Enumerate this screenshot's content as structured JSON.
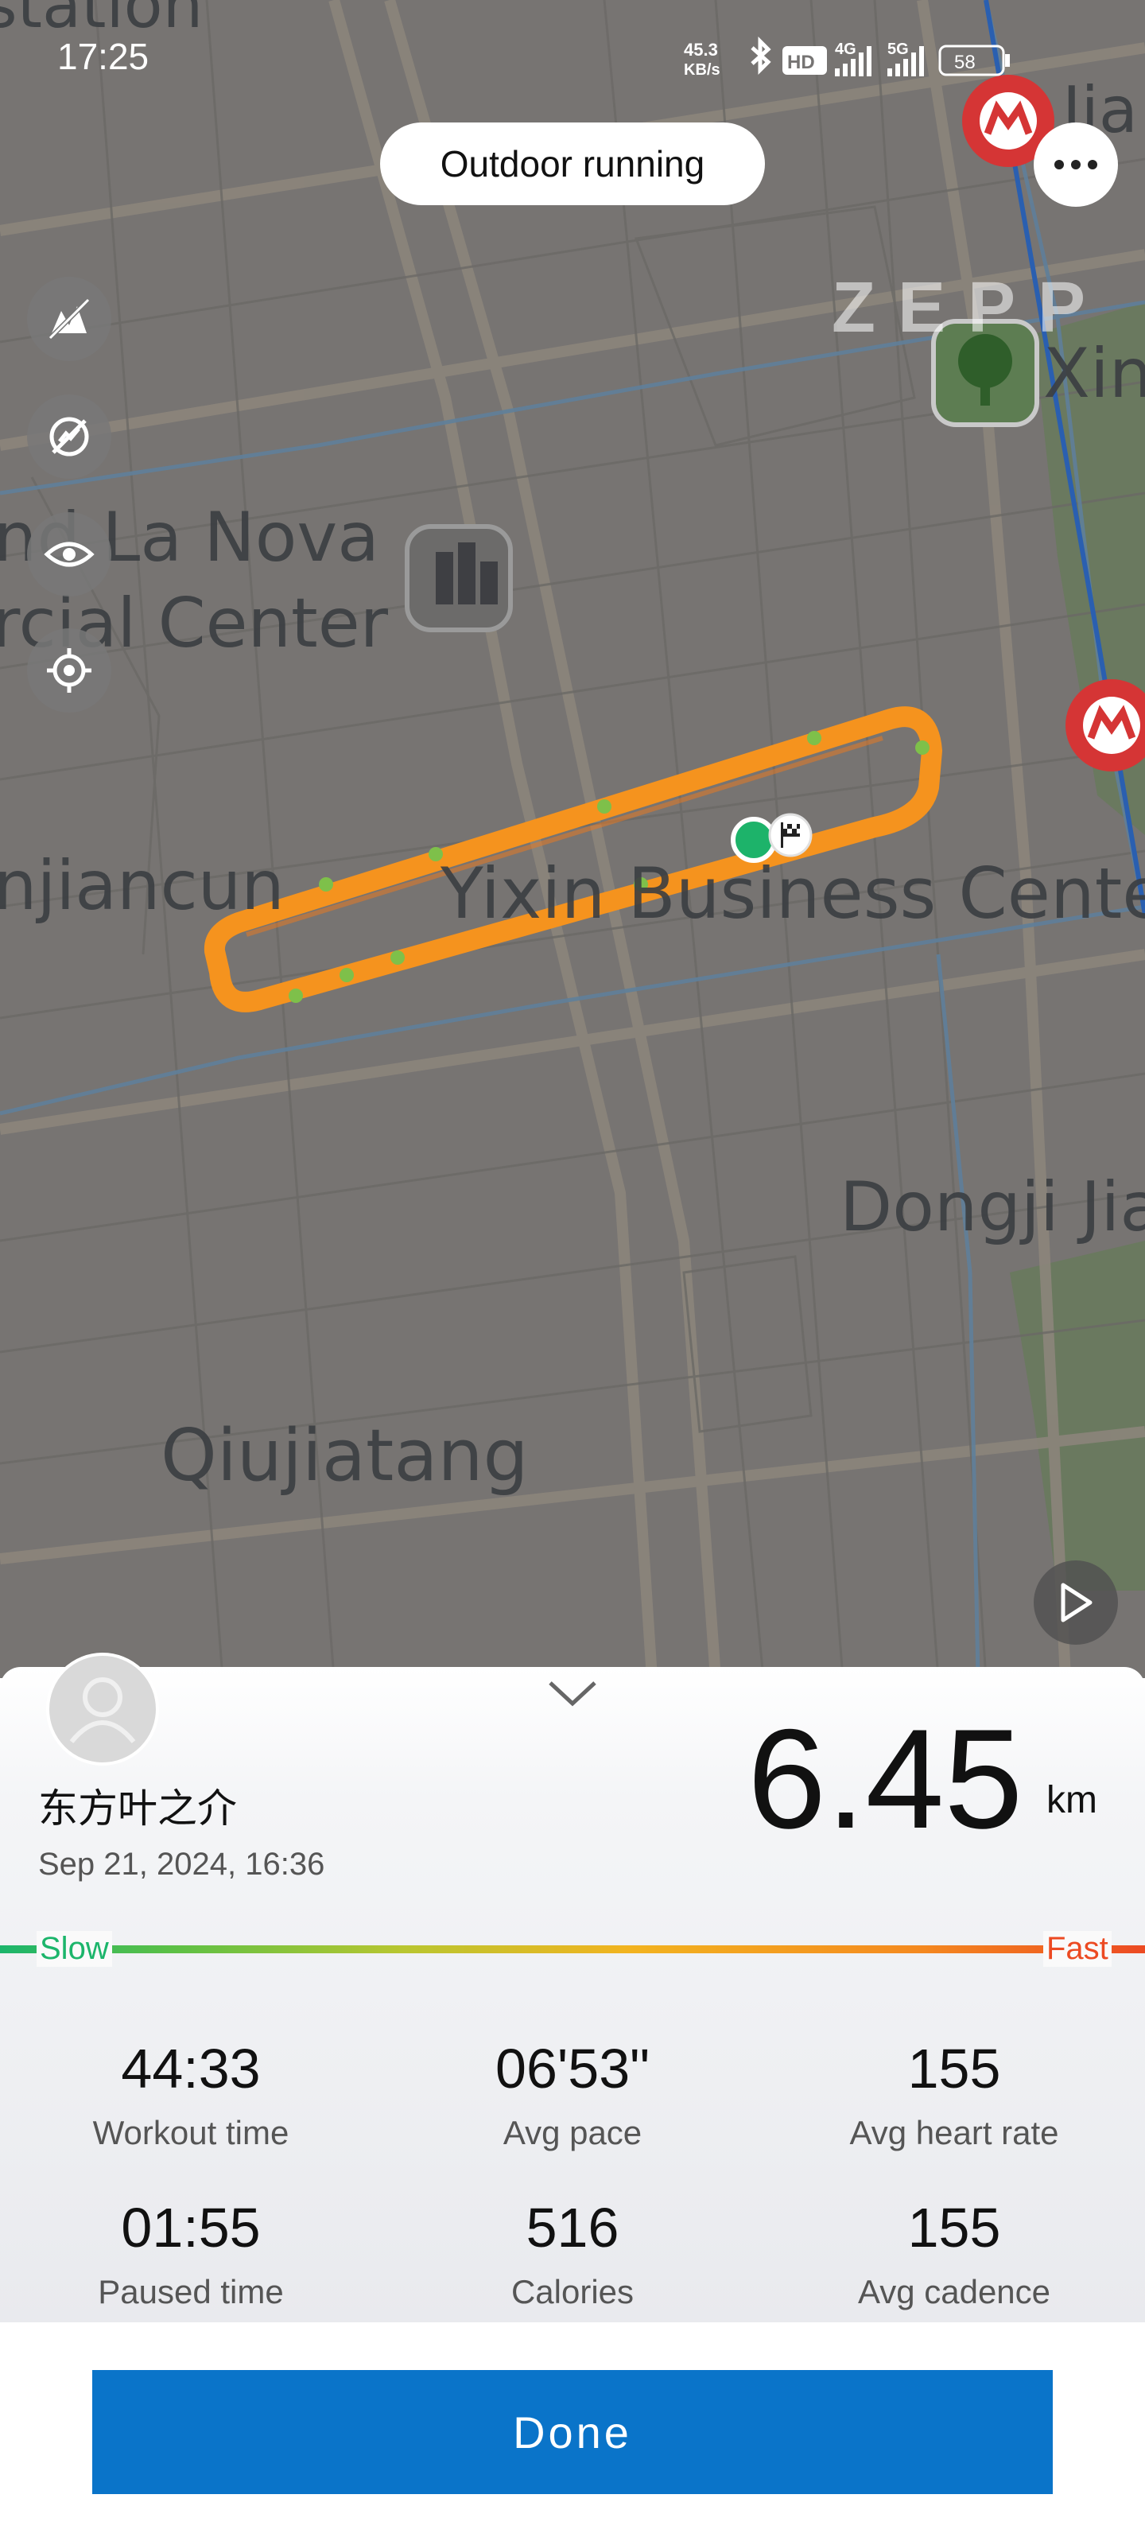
{
  "status_bar": {
    "time": "17:25",
    "net_speed_value": "45.3",
    "net_speed_unit": "KB/s",
    "hd_badge": "HD",
    "network_4g": "4G",
    "network_5g": "5G",
    "battery": "58"
  },
  "header": {
    "title": "Outdoor running",
    "more_icon": "more-horizontal-icon",
    "brand": "ZEPP"
  },
  "map": {
    "tools": [
      {
        "name": "map-style-icon"
      },
      {
        "name": "hide-heat-icon"
      },
      {
        "name": "eye-icon"
      },
      {
        "name": "locate-icon"
      }
    ],
    "labels": {
      "la_nova_1": "nd La Nova",
      "la_nova_2": "rcial Center",
      "jiancun": "njiancun",
      "yixin": "Yixin Business Cente",
      "dongji": "Dongji Jia",
      "qiujiatang": "Qiujiatang",
      "xin": "Xin",
      "top_cut": "station",
      "metro_ji": "Jia"
    },
    "play_icon": "play-icon"
  },
  "summary": {
    "user_name": "东方叶之介",
    "date": "Sep 21, 2024, 16:36",
    "distance": "6.45",
    "distance_unit": "km",
    "pace_slow_label": "Slow",
    "pace_fast_label": "Fast",
    "stats": [
      {
        "value": "44:33",
        "label": "Workout time"
      },
      {
        "value": "06'53\"",
        "label": "Avg pace"
      },
      {
        "value": "155",
        "label": "Avg heart rate"
      },
      {
        "value": "01:55",
        "label": "Paused time"
      },
      {
        "value": "516",
        "label": "Calories"
      },
      {
        "value": "155",
        "label": "Avg cadence"
      }
    ]
  },
  "colors": {
    "accent_blue": "#0a74c9",
    "route_orange": "#f5931e",
    "slow_green": "#1cb56b",
    "fast_red": "#ec4a22"
  },
  "done_label": "Done"
}
